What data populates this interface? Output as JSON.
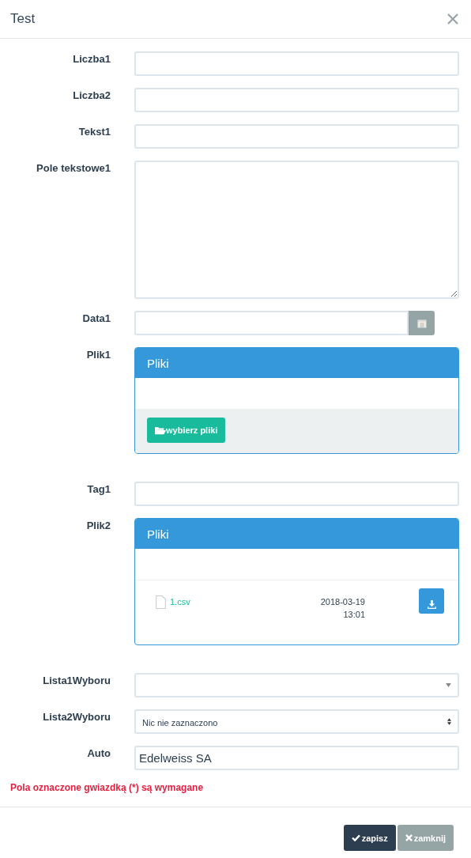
{
  "dialog": {
    "title": "Test"
  },
  "fields": [
    {
      "kind": "text",
      "label": "Liczba1"
    },
    {
      "kind": "text",
      "label": "Liczba2"
    },
    {
      "kind": "text",
      "label": "Tekst1"
    },
    {
      "kind": "textarea",
      "label": "Pole tekstowe1"
    },
    {
      "kind": "date",
      "label": "Data1"
    },
    {
      "kind": "files",
      "label": "Plik1",
      "panel_title": "Pliki",
      "upload_button": "wybierz pliki"
    },
    {
      "kind": "text",
      "label": "Tag1"
    },
    {
      "kind": "files",
      "label": "Plik2",
      "panel_title": "Pliki",
      "files": [
        {
          "name": "1.csv",
          "date": "2018-03-19",
          "time": "13:01"
        }
      ]
    },
    {
      "kind": "select",
      "label": "Lista1Wyboru"
    },
    {
      "kind": "multiselect",
      "label": "Lista2Wyboru",
      "value": "Nic nie zaznaczono"
    },
    {
      "kind": "text",
      "label": "Auto",
      "value": "Edelweiss SA"
    }
  ],
  "required_note": "Pola oznaczone gwiazdką (*) są wymagane",
  "buttons": [
    {
      "kind": "save",
      "label": "zapisz"
    },
    {
      "kind": "close",
      "label": "zamknij"
    }
  ]
}
